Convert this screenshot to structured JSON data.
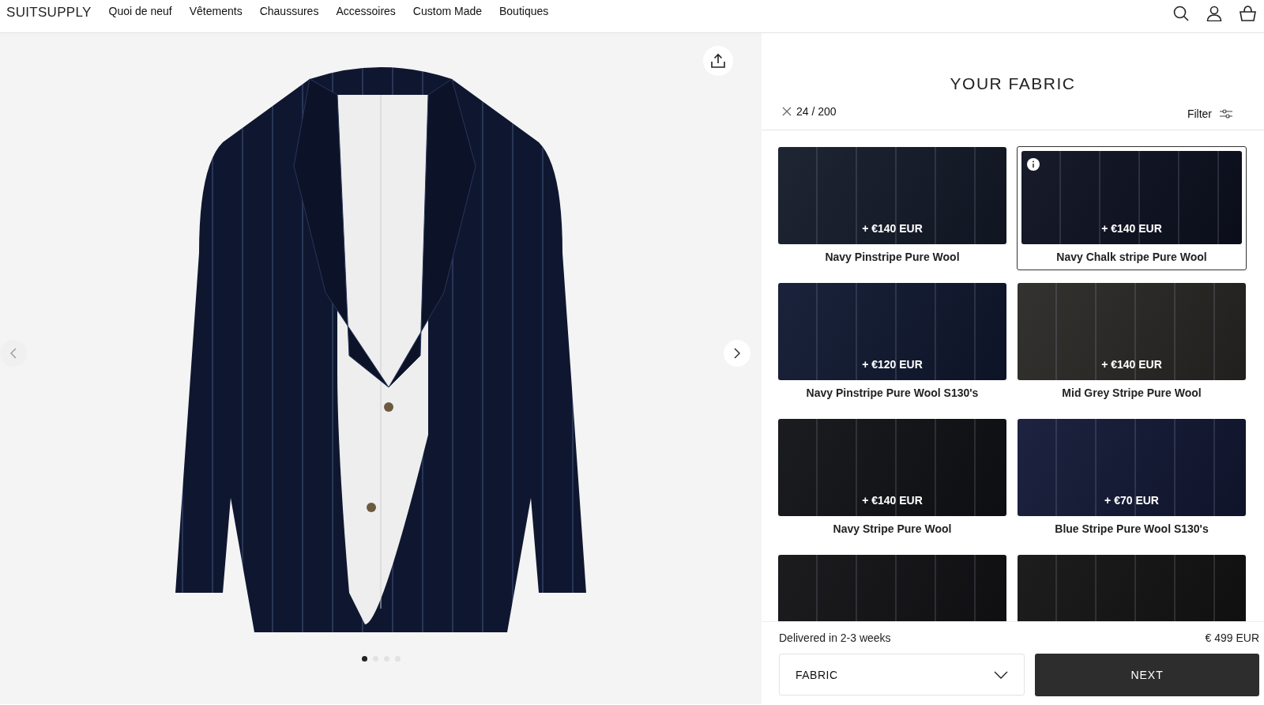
{
  "header": {
    "logo": "SUITSUPPLY",
    "nav": [
      "Quoi de neuf",
      "Vêtements",
      "Chaussures",
      "Accessoires",
      "Custom Made",
      "Boutiques"
    ]
  },
  "gallery": {
    "dots": [
      {
        "selected": true
      },
      {
        "selected": false
      },
      {
        "selected": false
      },
      {
        "selected": false
      }
    ]
  },
  "panel": {
    "title": "YOUR FABRIC",
    "count": "24 / 200",
    "filter": "Filter"
  },
  "fabrics": [
    {
      "price": "+ €140 EUR",
      "name": "Navy Pinstripe Pure Wool",
      "selected": false,
      "info": false,
      "color": "#151c2b"
    },
    {
      "price": "+ €140 EUR",
      "name": "Navy Chalk stripe Pure Wool",
      "selected": true,
      "info": true,
      "color": "#0e1222"
    },
    {
      "price": "+ €120 EUR",
      "name": "Navy Pinstripe Pure Wool S130's",
      "selected": false,
      "info": false,
      "color": "#111a33"
    },
    {
      "price": "+ €140 EUR",
      "name": "Mid Grey Stripe Pure Wool",
      "selected": false,
      "info": false,
      "color": "#2b2a27"
    },
    {
      "price": "+ €140 EUR",
      "name": "Navy Stripe Pure Wool",
      "selected": false,
      "info": false,
      "color": "#121317"
    },
    {
      "price": "+ €70 EUR",
      "name": "Blue Stripe Pure Wool S130's",
      "selected": false,
      "info": false,
      "color": "#141a38"
    },
    {
      "selected": false,
      "color": "#131316"
    },
    {
      "selected": false,
      "color": "#141414"
    }
  ],
  "footer": {
    "delivery": "Delivered in 2-3 weeks",
    "price": "€ 499 EUR",
    "step": "FABRIC",
    "next": "NEXT"
  }
}
